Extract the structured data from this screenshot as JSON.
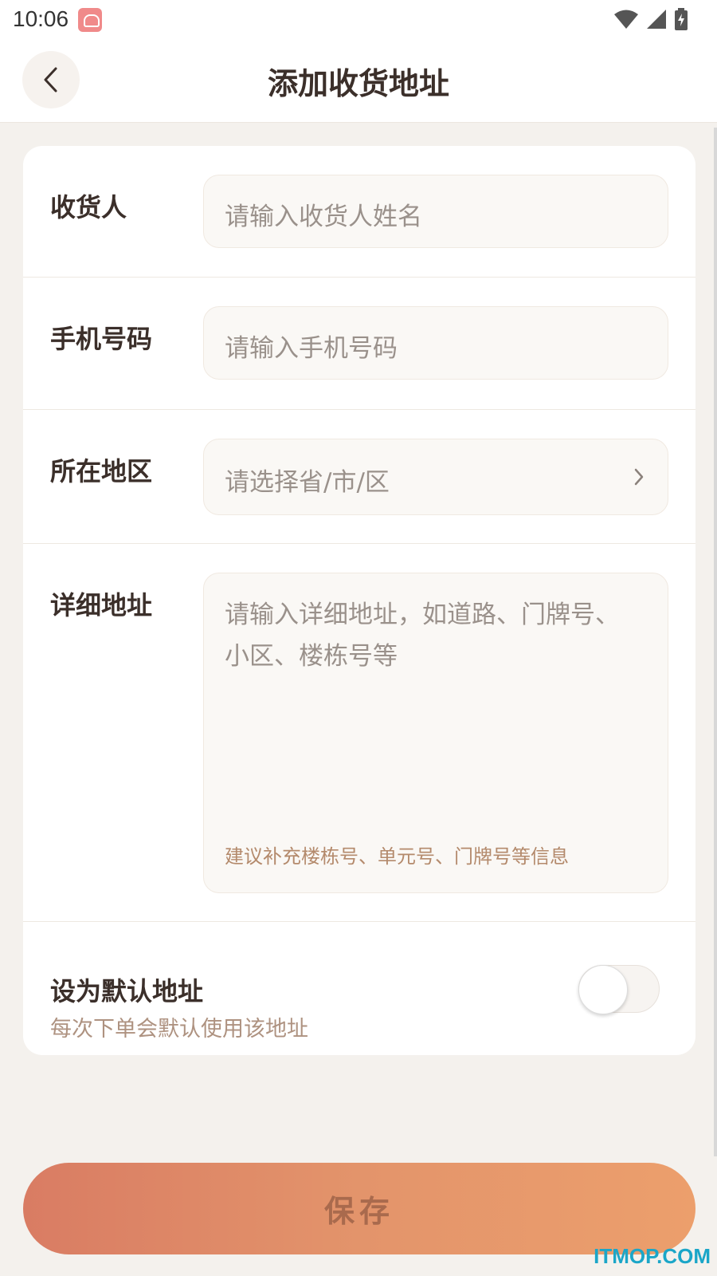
{
  "status_bar": {
    "time": "10:06",
    "icons": [
      "app-notification-icon",
      "wifi-icon",
      "signal-icon",
      "battery-charging-icon"
    ]
  },
  "header": {
    "title": "添加收货地址",
    "back_icon": "chevron-left-icon"
  },
  "form": {
    "recipient": {
      "label": "收货人",
      "placeholder": "请输入收货人姓名"
    },
    "phone": {
      "label": "手机号码",
      "placeholder": "请输入手机号码"
    },
    "region": {
      "label": "所在地区",
      "placeholder": "请选择省/市/区",
      "icon": "chevron-right-icon"
    },
    "detail": {
      "label": "详细地址",
      "placeholder": "请输入详细地址，如道路、门牌号、小区、楼栋号等",
      "hint": "建议补充楼栋号、单元号、门牌号等信息"
    },
    "default_address": {
      "title": "设为默认地址",
      "subtitle": "每次下单会默认使用该地址",
      "enabled": false
    }
  },
  "save_button": {
    "label": "保存"
  },
  "watermark": "ITMOP.COM",
  "colors": {
    "accent_start": "#d97c63",
    "accent_end": "#ec9f6c",
    "background": "#f4f1ed",
    "hint_text": "#b48a6c",
    "watermark": "#1ba6c8"
  }
}
